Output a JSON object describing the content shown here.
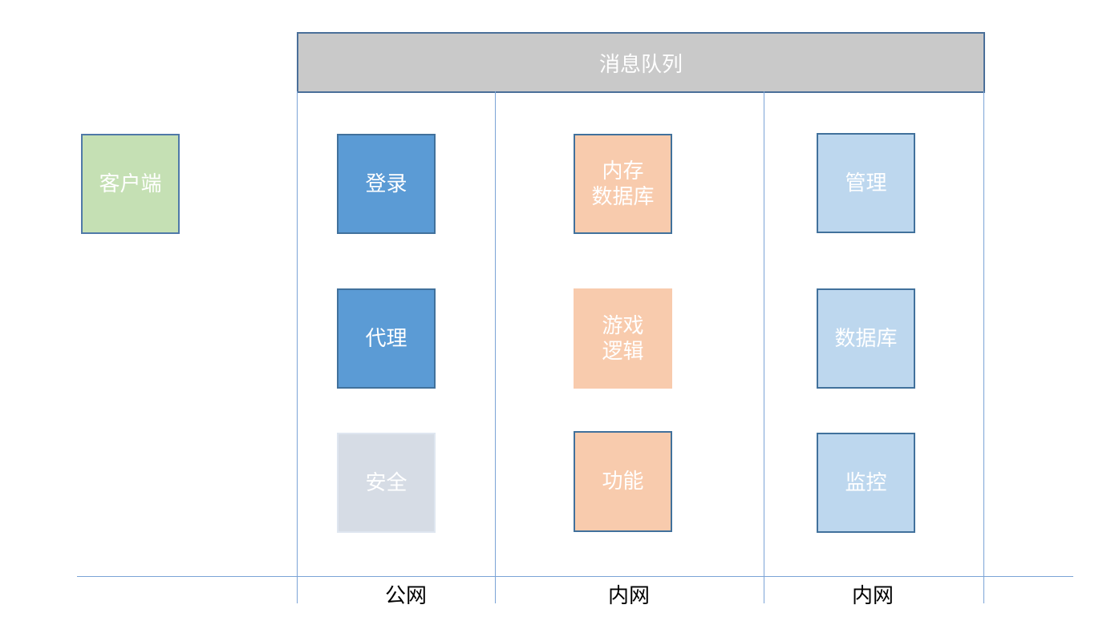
{
  "message_queue": {
    "label": "消息队列"
  },
  "client": {
    "label": "客户端"
  },
  "public_zone": {
    "boxes": [
      {
        "label": "登录"
      },
      {
        "label": "代理"
      },
      {
        "label": "安全"
      }
    ],
    "zone_label": "公网"
  },
  "internal_zone_1": {
    "boxes": [
      {
        "label": "内存\n数据库"
      },
      {
        "label": "游戏\n逻辑"
      },
      {
        "label": "功能"
      }
    ],
    "zone_label": "内网"
  },
  "internal_zone_2": {
    "boxes": [
      {
        "label": "管理"
      },
      {
        "label": "数据库"
      },
      {
        "label": "监控"
      }
    ],
    "zone_label": "内网"
  },
  "colors": {
    "client": "#c5e0b4",
    "public": "#5b9bd5",
    "security": "#d6dce5",
    "internal_1": "#f8cbad",
    "internal_2": "#bdd7ee",
    "message_queue": "#c9c9c9",
    "divider": "#7ba3d6"
  }
}
